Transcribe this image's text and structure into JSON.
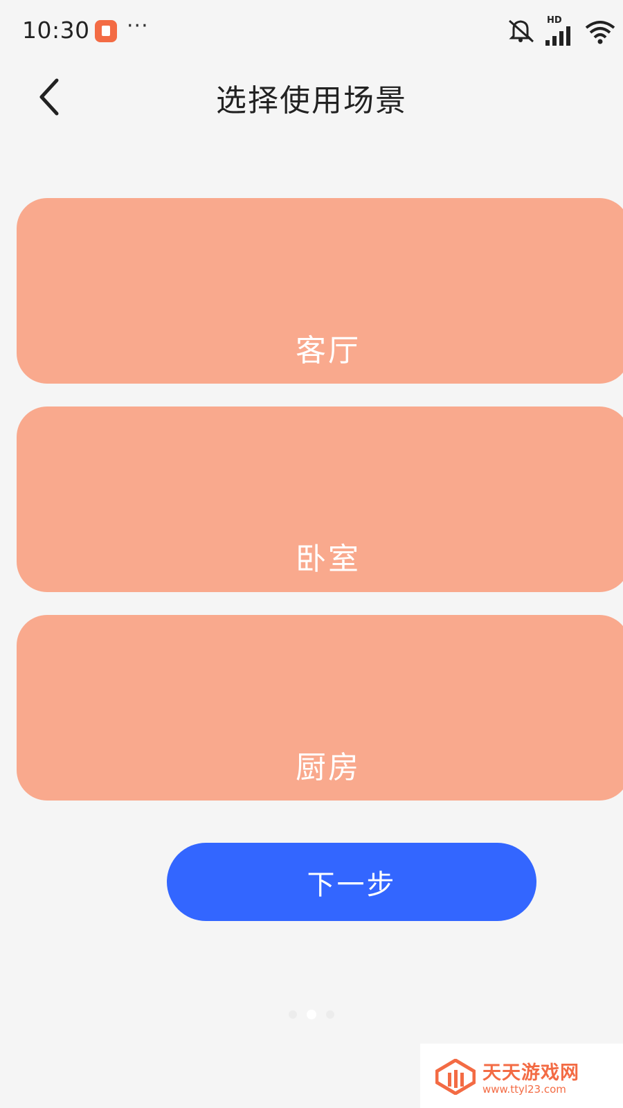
{
  "status_bar": {
    "time": "10:30",
    "more": "···",
    "hd": "HD",
    "icons": [
      "notification-app-icon",
      "more-icon",
      "mute-icon",
      "signal-icon",
      "wifi-icon"
    ]
  },
  "header": {
    "title": "选择使用场景",
    "back_icon": "chevron-left-icon"
  },
  "scenes": [
    {
      "label": "客厅"
    },
    {
      "label": "卧室"
    },
    {
      "label": "厨房"
    }
  ],
  "next_button": {
    "label": "下一步"
  },
  "pagination": {
    "count": 3,
    "active_index": 1
  },
  "watermark": {
    "title": "天天游戏网",
    "url": "www.ttyl23.com"
  },
  "colors": {
    "background": "#f5f5f5",
    "card": "#f9a98d",
    "primary": "#3366ff",
    "brand": "#f36b44"
  }
}
